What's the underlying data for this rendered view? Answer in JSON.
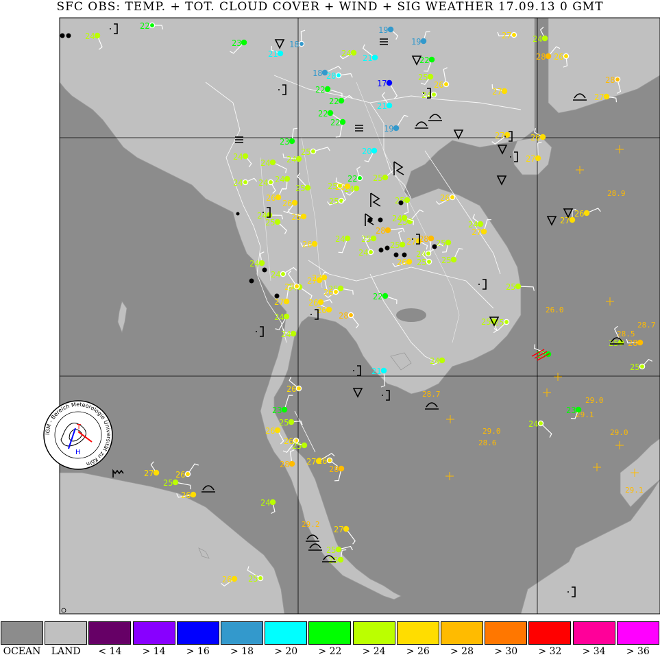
{
  "title": "SFC OBS: TEMP. + TOT. CLOUD COVER + WIND + SIG WEATHER 17.09.13 0  GMT",
  "logo_text": "IGM - Bereich Meteorologie  Universität zu Köln",
  "colors": {
    "ocean": "#8c8c8c",
    "land": "#c0c0c0",
    "t_lt14": "#660066",
    "t_gt14": "#8800ff",
    "t_gt16": "#0000ff",
    "t_gt18": "#3399cc",
    "t_gt20": "#00ffff",
    "t_gt22": "#00ff00",
    "t_gt24": "#bbff00",
    "t_gt26": "#ffdd00",
    "t_gt28": "#ffbb00",
    "t_gt30": "#ff7700",
    "t_gt32": "#ff0000",
    "t_gt34": "#ff0099",
    "t_gt36": "#ff00ff"
  },
  "legend": [
    {
      "label": "OCEAN",
      "color": "#8c8c8c"
    },
    {
      "label": "LAND",
      "color": "#c0c0c0"
    },
    {
      "label": "< 14",
      "color": "#660066"
    },
    {
      "label": "> 14",
      "color": "#8800ff"
    },
    {
      "label": "> 16",
      "color": "#0000ff"
    },
    {
      "label": "> 18",
      "color": "#3399cc"
    },
    {
      "label": "> 20",
      "color": "#00ffff"
    },
    {
      "label": "> 22",
      "color": "#00ff00"
    },
    {
      "label": "> 24",
      "color": "#bbff00"
    },
    {
      "label": "> 26",
      "color": "#ffdd00"
    },
    {
      "label": "> 28",
      "color": "#ffbb00"
    },
    {
      "label": "> 30",
      "color": "#ff7700"
    },
    {
      "label": "> 32",
      "color": "#ff0000"
    },
    {
      "label": "> 34",
      "color": "#ff0099"
    },
    {
      "label": "> 36",
      "color": "#ff00ff"
    }
  ],
  "stations": [
    {
      "t": "22"
    },
    {
      "t": "24"
    },
    {
      "t": "23"
    },
    {
      "t": "21"
    },
    {
      "t": "18"
    },
    {
      "t": "18"
    },
    {
      "t": "19"
    },
    {
      "t": "22"
    },
    {
      "t": "27"
    },
    {
      "t": "24"
    },
    {
      "t": "28"
    },
    {
      "t": "22"
    },
    {
      "t": "26"
    },
    {
      "t": "24"
    },
    {
      "t": "21"
    },
    {
      "t": "19"
    },
    {
      "t": "20"
    },
    {
      "t": "17"
    },
    {
      "t": "25"
    },
    {
      "t": "27"
    },
    {
      "t": "26"
    },
    {
      "t": "22"
    },
    {
      "t": "22"
    },
    {
      "t": "22"
    },
    {
      "t": "24"
    },
    {
      "t": "21"
    },
    {
      "t": "19"
    },
    {
      "t": "27"
    },
    {
      "t": "28"
    },
    {
      "t": "27"
    },
    {
      "t": "26"
    },
    {
      "t": "23"
    },
    {
      "t": "25"
    },
    {
      "t": "24"
    },
    {
      "t": "20"
    },
    {
      "t": "24"
    },
    {
      "t": "22"
    },
    {
      "t": "25"
    },
    {
      "t": "24"
    },
    {
      "t": "24"
    },
    {
      "t": "25"
    },
    {
      "t": "25"
    },
    {
      "t": "26"
    },
    {
      "t": "24"
    },
    {
      "t": "25"
    },
    {
      "t": "24"
    },
    {
      "t": "26"
    },
    {
      "t": "27"
    },
    {
      "t": "24"
    },
    {
      "t": "25"
    },
    {
      "t": "24"
    },
    {
      "t": "25"
    },
    {
      "t": "24"
    },
    {
      "t": "25"
    },
    {
      "t": "24"
    },
    {
      "t": "25"
    },
    {
      "t": "26"
    },
    {
      "t": "24"
    },
    {
      "t": "27"
    },
    {
      "t": "28"
    },
    {
      "t": "24"
    },
    {
      "t": "26"
    },
    {
      "t": "26"
    },
    {
      "t": "24"
    },
    {
      "t": "24"
    },
    {
      "t": "24"
    },
    {
      "t": "25"
    },
    {
      "t": "26"
    },
    {
      "t": "27"
    },
    {
      "t": "27"
    },
    {
      "t": "25"
    },
    {
      "t": "27"
    },
    {
      "t": "26"
    },
    {
      "t": "26"
    },
    {
      "t": "27"
    },
    {
      "t": "26"
    },
    {
      "t": "28"
    },
    {
      "t": "24"
    },
    {
      "t": "24"
    },
    {
      "t": "25"
    },
    {
      "t": "24"
    },
    {
      "t": "27"
    },
    {
      "t": "28"
    },
    {
      "t": "26"
    },
    {
      "t": "25"
    },
    {
      "t": "25"
    },
    {
      "t": "25"
    },
    {
      "t": "25"
    },
    {
      "t": "25"
    },
    {
      "t": "23"
    },
    {
      "t": "27"
    },
    {
      "t": "26"
    },
    {
      "t": "24"
    },
    {
      "t": "23"
    },
    {
      "t": "28"
    },
    {
      "t": "25"
    },
    {
      "t": "25"
    },
    {
      "t": "22"
    },
    {
      "t": "21"
    },
    {
      "t": "24"
    },
    {
      "t": "26"
    },
    {
      "t": "23"
    },
    {
      "t": "25"
    },
    {
      "t": "26"
    },
    {
      "t": "26"
    },
    {
      "t": "25"
    },
    {
      "t": "28"
    },
    {
      "t": "27"
    },
    {
      "t": "26"
    },
    {
      "t": "28"
    },
    {
      "t": "26"
    },
    {
      "t": "27"
    },
    {
      "t": "26"
    },
    {
      "t": "25"
    },
    {
      "t": "24"
    },
    {
      "t": "26"
    },
    {
      "t": "25"
    },
    {
      "t": "25"
    },
    {
      "t": "25"
    },
    {
      "t": "27"
    },
    {
      "t": "28"
    },
    {
      "t": "27"
    },
    {
      "t": "26"
    },
    {
      "t": "26"
    },
    {
      "t": "25"
    },
    {
      "t": "25"
    },
    {
      "t": "24"
    },
    {
      "t": "25"
    },
    {
      "t": "26"
    },
    {
      "t": "24"
    }
  ],
  "sst_values": [
    "28.9",
    "26.0",
    "28.7",
    "28.5",
    "29.0",
    "29.1",
    "29.0",
    "28.6",
    "29.0",
    "29.1",
    "29.2",
    "28.7"
  ]
}
